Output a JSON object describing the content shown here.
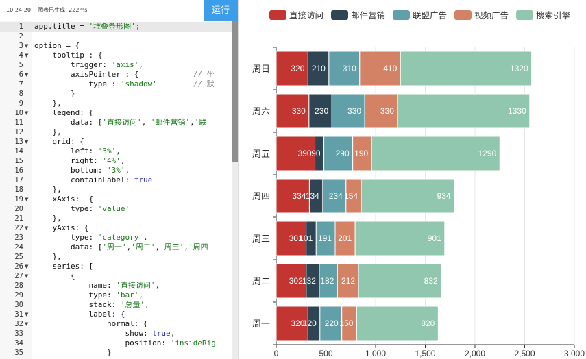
{
  "status": "10:24:20    图表已生成, 222ms",
  "run_label": "运行",
  "code_lines": [
    {
      "n": "1",
      "fold": "",
      "segs": [
        [
          "t",
          "app.title = "
        ],
        [
          "s",
          "'堆叠条形图'"
        ],
        [
          "t",
          ";"
        ]
      ]
    },
    {
      "n": "2",
      "fold": "",
      "segs": []
    },
    {
      "n": "3",
      "fold": "▼",
      "segs": [
        [
          "t",
          "option = {"
        ]
      ]
    },
    {
      "n": "4",
      "fold": "▼",
      "segs": [
        [
          "t",
          "    tooltip : {"
        ]
      ]
    },
    {
      "n": "5",
      "fold": "",
      "segs": [
        [
          "t",
          "        trigger: "
        ],
        [
          "s",
          "'axis'"
        ],
        [
          "t",
          ","
        ]
      ]
    },
    {
      "n": "6",
      "fold": "▼",
      "segs": [
        [
          "t",
          "        axisPointer : {            "
        ],
        [
          "c",
          "// 坐"
        ]
      ]
    },
    {
      "n": "7",
      "fold": "",
      "segs": [
        [
          "t",
          "            type : "
        ],
        [
          "s",
          "'shadow'"
        ],
        [
          "t",
          "        "
        ],
        [
          "c",
          "// 默"
        ]
      ]
    },
    {
      "n": "8",
      "fold": "",
      "segs": [
        [
          "t",
          "        }"
        ]
      ]
    },
    {
      "n": "9",
      "fold": "",
      "segs": [
        [
          "t",
          "    },"
        ]
      ]
    },
    {
      "n": "10",
      "fold": "▼",
      "segs": [
        [
          "t",
          "    legend: {"
        ]
      ]
    },
    {
      "n": "11",
      "fold": "",
      "segs": [
        [
          "t",
          "        data: ["
        ],
        [
          "s",
          "'直接访问'"
        ],
        [
          "t",
          ", "
        ],
        [
          "s",
          "'邮件营销'"
        ],
        [
          "t",
          ","
        ],
        [
          "s",
          "'联"
        ]
      ]
    },
    {
      "n": "12",
      "fold": "",
      "segs": [
        [
          "t",
          "    },"
        ]
      ]
    },
    {
      "n": "13",
      "fold": "▼",
      "segs": [
        [
          "t",
          "    grid: {"
        ]
      ]
    },
    {
      "n": "14",
      "fold": "",
      "segs": [
        [
          "t",
          "        left: "
        ],
        [
          "s",
          "'3%'"
        ],
        [
          "t",
          ","
        ]
      ]
    },
    {
      "n": "15",
      "fold": "",
      "segs": [
        [
          "t",
          "        right: "
        ],
        [
          "s",
          "'4%'"
        ],
        [
          "t",
          ","
        ]
      ]
    },
    {
      "n": "16",
      "fold": "",
      "segs": [
        [
          "t",
          "        bottom: "
        ],
        [
          "s",
          "'3%'"
        ],
        [
          "t",
          ","
        ]
      ]
    },
    {
      "n": "17",
      "fold": "",
      "segs": [
        [
          "t",
          "        containLabel: "
        ],
        [
          "k",
          "true"
        ]
      ]
    },
    {
      "n": "18",
      "fold": "",
      "segs": [
        [
          "t",
          "    },"
        ]
      ]
    },
    {
      "n": "19",
      "fold": "▼",
      "segs": [
        [
          "t",
          "    xAxis:  {"
        ]
      ]
    },
    {
      "n": "20",
      "fold": "",
      "segs": [
        [
          "t",
          "        type: "
        ],
        [
          "s",
          "'value'"
        ]
      ]
    },
    {
      "n": "21",
      "fold": "",
      "segs": [
        [
          "t",
          "    },"
        ]
      ]
    },
    {
      "n": "22",
      "fold": "▼",
      "segs": [
        [
          "t",
          "    yAxis: {"
        ]
      ]
    },
    {
      "n": "23",
      "fold": "",
      "segs": [
        [
          "t",
          "        type: "
        ],
        [
          "s",
          "'category'"
        ],
        [
          "t",
          ","
        ]
      ]
    },
    {
      "n": "24",
      "fold": "",
      "segs": [
        [
          "t",
          "        data: ["
        ],
        [
          "s",
          "'周一'"
        ],
        [
          "t",
          ","
        ],
        [
          "s",
          "'周二'"
        ],
        [
          "t",
          ","
        ],
        [
          "s",
          "'周三'"
        ],
        [
          "t",
          ","
        ],
        [
          "s",
          "'周四"
        ]
      ]
    },
    {
      "n": "25",
      "fold": "",
      "segs": [
        [
          "t",
          "    },"
        ]
      ]
    },
    {
      "n": "26",
      "fold": "▼",
      "segs": [
        [
          "t",
          "    series: ["
        ]
      ]
    },
    {
      "n": "27",
      "fold": "▼",
      "segs": [
        [
          "t",
          "        {"
        ]
      ]
    },
    {
      "n": "28",
      "fold": "",
      "segs": [
        [
          "t",
          "            name: "
        ],
        [
          "s",
          "'直接访问'"
        ],
        [
          "t",
          ","
        ]
      ]
    },
    {
      "n": "29",
      "fold": "",
      "segs": [
        [
          "t",
          "            type: "
        ],
        [
          "s",
          "'bar'"
        ],
        [
          "t",
          ","
        ]
      ]
    },
    {
      "n": "30",
      "fold": "",
      "segs": [
        [
          "t",
          "            stack: "
        ],
        [
          "s",
          "'总量'"
        ],
        [
          "t",
          ","
        ]
      ]
    },
    {
      "n": "31",
      "fold": "▼",
      "segs": [
        [
          "t",
          "            label: {"
        ]
      ]
    },
    {
      "n": "32",
      "fold": "▼",
      "segs": [
        [
          "t",
          "                normal: {"
        ]
      ]
    },
    {
      "n": "33",
      "fold": "",
      "segs": [
        [
          "t",
          "                    show: "
        ],
        [
          "k",
          "true"
        ],
        [
          "t",
          ","
        ]
      ]
    },
    {
      "n": "34",
      "fold": "",
      "segs": [
        [
          "t",
          "                    position: "
        ],
        [
          "s",
          "'insideRig"
        ]
      ]
    },
    {
      "n": "35",
      "fold": "",
      "segs": [
        [
          "t",
          "                }"
        ]
      ]
    }
  ],
  "chart_data": {
    "type": "bar",
    "orientation": "horizontal",
    "stacked": true,
    "categories": [
      "周一",
      "周二",
      "周三",
      "周四",
      "周五",
      "周六",
      "周日"
    ],
    "series": [
      {
        "name": "直接访问",
        "color": "#c23531",
        "values": [
          320,
          302,
          301,
          334,
          390,
          330,
          320
        ]
      },
      {
        "name": "邮件营销",
        "color": "#2f4554",
        "values": [
          120,
          132,
          101,
          134,
          90,
          230,
          210
        ]
      },
      {
        "name": "联盟广告",
        "color": "#61a0a8",
        "values": [
          220,
          182,
          191,
          234,
          290,
          330,
          310
        ]
      },
      {
        "name": "视频广告",
        "color": "#d48265",
        "values": [
          150,
          212,
          201,
          154,
          190,
          330,
          410
        ]
      },
      {
        "name": "搜索引擎",
        "color": "#91c7ae",
        "values": [
          820,
          832,
          901,
          934,
          1290,
          1330,
          1320
        ]
      }
    ],
    "xlim": [
      0,
      3000
    ],
    "xticks": [
      0,
      500,
      1000,
      1500,
      2000,
      2500,
      3000
    ],
    "xtick_labels": [
      "0",
      "500",
      "1,000",
      "1,500",
      "2,000",
      "2,500",
      "3,000"
    ],
    "legend_position": "top",
    "grid": true
  }
}
